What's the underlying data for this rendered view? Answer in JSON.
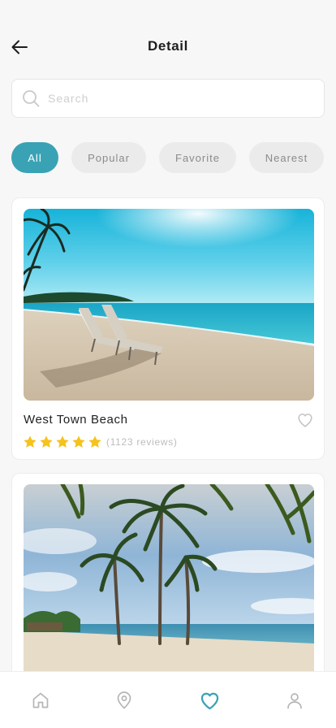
{
  "header": {
    "title": "Detail",
    "back_icon": "arrow-left-icon"
  },
  "search": {
    "placeholder": "Search",
    "value": "",
    "icon": "search-icon"
  },
  "filters": [
    {
      "label": "All",
      "active": true
    },
    {
      "label": "Popular",
      "active": false
    },
    {
      "label": "Favorite",
      "active": false
    },
    {
      "label": "Nearest",
      "active": false
    }
  ],
  "places": [
    {
      "name": "West Town Beach",
      "rating": 5,
      "reviews_text": "(1123 reviews)",
      "favorite": false
    },
    {
      "name": "",
      "rating": null,
      "reviews_text": "",
      "favorite": false
    }
  ],
  "tabbar": {
    "items": [
      {
        "icon": "home-icon",
        "active": false
      },
      {
        "icon": "location-pin-icon",
        "active": false
      },
      {
        "icon": "heart-icon",
        "active": true
      },
      {
        "icon": "profile-icon",
        "active": false
      }
    ]
  },
  "colors": {
    "accent": "#3aa2b5",
    "star": "#f6c21c",
    "chip_inactive_bg": "#ebebeb",
    "chip_inactive_text": "#8b8b8b",
    "tab_inactive": "#b5b5b5"
  }
}
